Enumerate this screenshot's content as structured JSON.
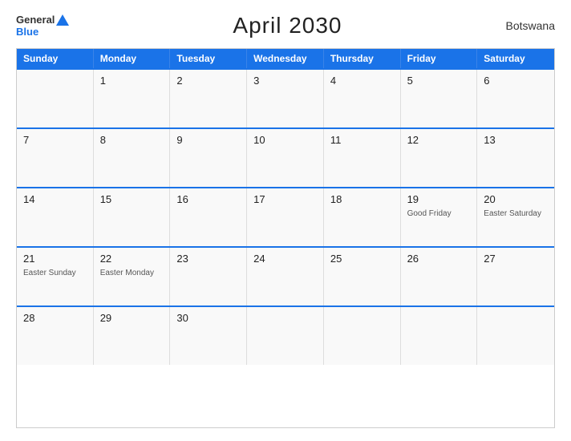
{
  "header": {
    "logo_general": "General",
    "logo_blue": "Blue",
    "title": "April 2030",
    "country": "Botswana"
  },
  "calendar": {
    "days_of_week": [
      "Sunday",
      "Monday",
      "Tuesday",
      "Wednesday",
      "Thursday",
      "Friday",
      "Saturday"
    ],
    "weeks": [
      [
        {
          "day": "",
          "holiday": ""
        },
        {
          "day": "1",
          "holiday": ""
        },
        {
          "day": "2",
          "holiday": ""
        },
        {
          "day": "3",
          "holiday": ""
        },
        {
          "day": "4",
          "holiday": ""
        },
        {
          "day": "5",
          "holiday": ""
        },
        {
          "day": "6",
          "holiday": ""
        }
      ],
      [
        {
          "day": "7",
          "holiday": ""
        },
        {
          "day": "8",
          "holiday": ""
        },
        {
          "day": "9",
          "holiday": ""
        },
        {
          "day": "10",
          "holiday": ""
        },
        {
          "day": "11",
          "holiday": ""
        },
        {
          "day": "12",
          "holiday": ""
        },
        {
          "day": "13",
          "holiday": ""
        }
      ],
      [
        {
          "day": "14",
          "holiday": ""
        },
        {
          "day": "15",
          "holiday": ""
        },
        {
          "day": "16",
          "holiday": ""
        },
        {
          "day": "17",
          "holiday": ""
        },
        {
          "day": "18",
          "holiday": ""
        },
        {
          "day": "19",
          "holiday": "Good Friday"
        },
        {
          "day": "20",
          "holiday": "Easter Saturday"
        }
      ],
      [
        {
          "day": "21",
          "holiday": "Easter Sunday"
        },
        {
          "day": "22",
          "holiday": "Easter Monday"
        },
        {
          "day": "23",
          "holiday": ""
        },
        {
          "day": "24",
          "holiday": ""
        },
        {
          "day": "25",
          "holiday": ""
        },
        {
          "day": "26",
          "holiday": ""
        },
        {
          "day": "27",
          "holiday": ""
        }
      ],
      [
        {
          "day": "28",
          "holiday": ""
        },
        {
          "day": "29",
          "holiday": ""
        },
        {
          "day": "30",
          "holiday": ""
        },
        {
          "day": "",
          "holiday": ""
        },
        {
          "day": "",
          "holiday": ""
        },
        {
          "day": "",
          "holiday": ""
        },
        {
          "day": "",
          "holiday": ""
        }
      ]
    ]
  }
}
